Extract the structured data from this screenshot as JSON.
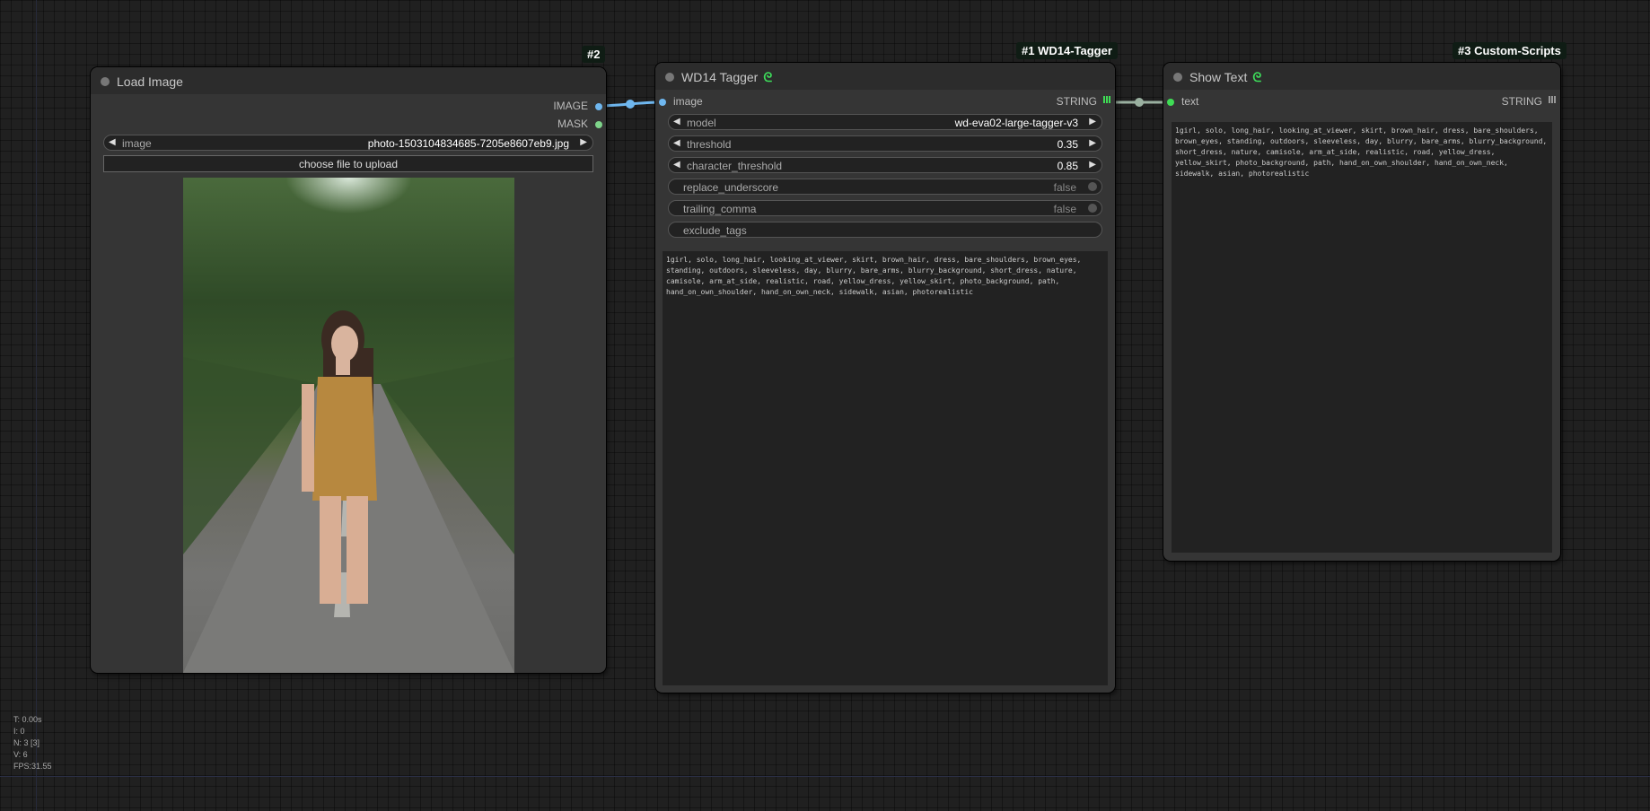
{
  "colors": {
    "canvas": "#202020",
    "node_body": "#353535",
    "node_title": "#2c2c2c",
    "image_link": "#6fb7ef",
    "string_link": "#9ab0a0",
    "accent_green": "#3fdc55"
  },
  "badges": {
    "node2": "#2",
    "node1": "#1 WD14-Tagger",
    "node3": "#3 Custom-Scripts"
  },
  "load_image": {
    "title": "Load Image",
    "outputs": [
      "IMAGE",
      "MASK"
    ],
    "image_widget": {
      "label": "image",
      "value": "photo-1503104834685-7205e8607eb9.jpg"
    },
    "upload_button": "choose file to upload",
    "preview_icon": "image-preview"
  },
  "tagger": {
    "title": "WD14 Tagger",
    "title_icon": "link-icon",
    "input": "image",
    "output": "STRING",
    "widgets": {
      "model": {
        "label": "model",
        "value": "wd-eva02-large-tagger-v3"
      },
      "threshold": {
        "label": "threshold",
        "value": "0.35"
      },
      "character_threshold": {
        "label": "character_threshold",
        "value": "0.85"
      },
      "replace_underscore": {
        "label": "replace_underscore",
        "value": "false"
      },
      "trailing_comma": {
        "label": "trailing_comma",
        "value": "false"
      },
      "exclude_tags": {
        "label": "exclude_tags"
      }
    },
    "result": "1girl, solo, long_hair, looking_at_viewer, skirt, brown_hair, dress, bare_shoulders, brown_eyes, standing, outdoors, sleeveless, day, blurry, bare_arms, blurry_background, short_dress, nature, camisole, arm_at_side, realistic, road, yellow_dress, yellow_skirt, photo_background, path, hand_on_own_shoulder, hand_on_own_neck, sidewalk, asian, photorealistic"
  },
  "show_text": {
    "title": "Show Text",
    "title_icon": "link-icon",
    "input": "text",
    "output": "STRING",
    "text": "1girl, solo, long_hair, looking_at_viewer, skirt, brown_hair, dress, bare_shoulders, brown_eyes, standing, outdoors, sleeveless, day, blurry, bare_arms, blurry_background, short_dress, nature, camisole, arm_at_side, realistic, road, yellow_dress, yellow_skirt, photo_background, path, hand_on_own_shoulder, hand_on_own_neck, sidewalk, asian, photorealistic"
  },
  "stats": {
    "t": "T: 0.00s",
    "i": "I: 0",
    "n": "N: 3 [3]",
    "v": "V: 6",
    "fps": "FPS:31.55"
  }
}
